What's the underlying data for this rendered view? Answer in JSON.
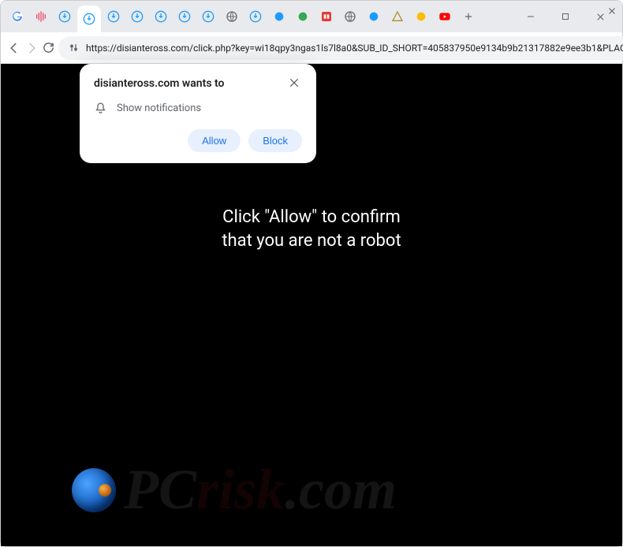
{
  "window": {
    "url_display": "https://disianteross.com/click.php?key=wi18qpy3ngas1ls7l8a0&SUB_ID_SHORT=405837950e9134b9b21317882e9ee3b1&PLACEMEN..."
  },
  "tabs": {
    "count": 19
  },
  "permission": {
    "title": "disianteross.com wants to",
    "option": "Show notifications",
    "allow_label": "Allow",
    "block_label": "Block"
  },
  "page": {
    "line1": "Click \"Allow\" to confirm",
    "line2": "that you are not a robot"
  },
  "watermark": {
    "part1": "PC",
    "part2": "risk",
    "part3": ".com"
  }
}
